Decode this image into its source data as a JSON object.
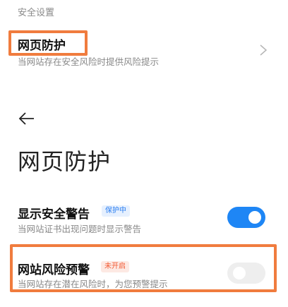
{
  "section_header": "安全设置",
  "web_protection_item": {
    "title": "网页防护",
    "subtitle": "当网站存在安全风险时提供风险提示"
  },
  "page": {
    "title": "网页防护"
  },
  "security_warning": {
    "title": "显示安全警告",
    "badge": "保护中",
    "subtitle": "当网站证书出现问题时显示警告",
    "enabled": true
  },
  "risk_alert": {
    "title": "网站风险预警",
    "badge": "未开启",
    "subtitle": "当网站存在潜在风险时，为您预警提示",
    "enabled": false
  },
  "colors": {
    "accent": "#1e86f5",
    "highlight": "#f07c3e",
    "badge_off": "#f25b35"
  }
}
